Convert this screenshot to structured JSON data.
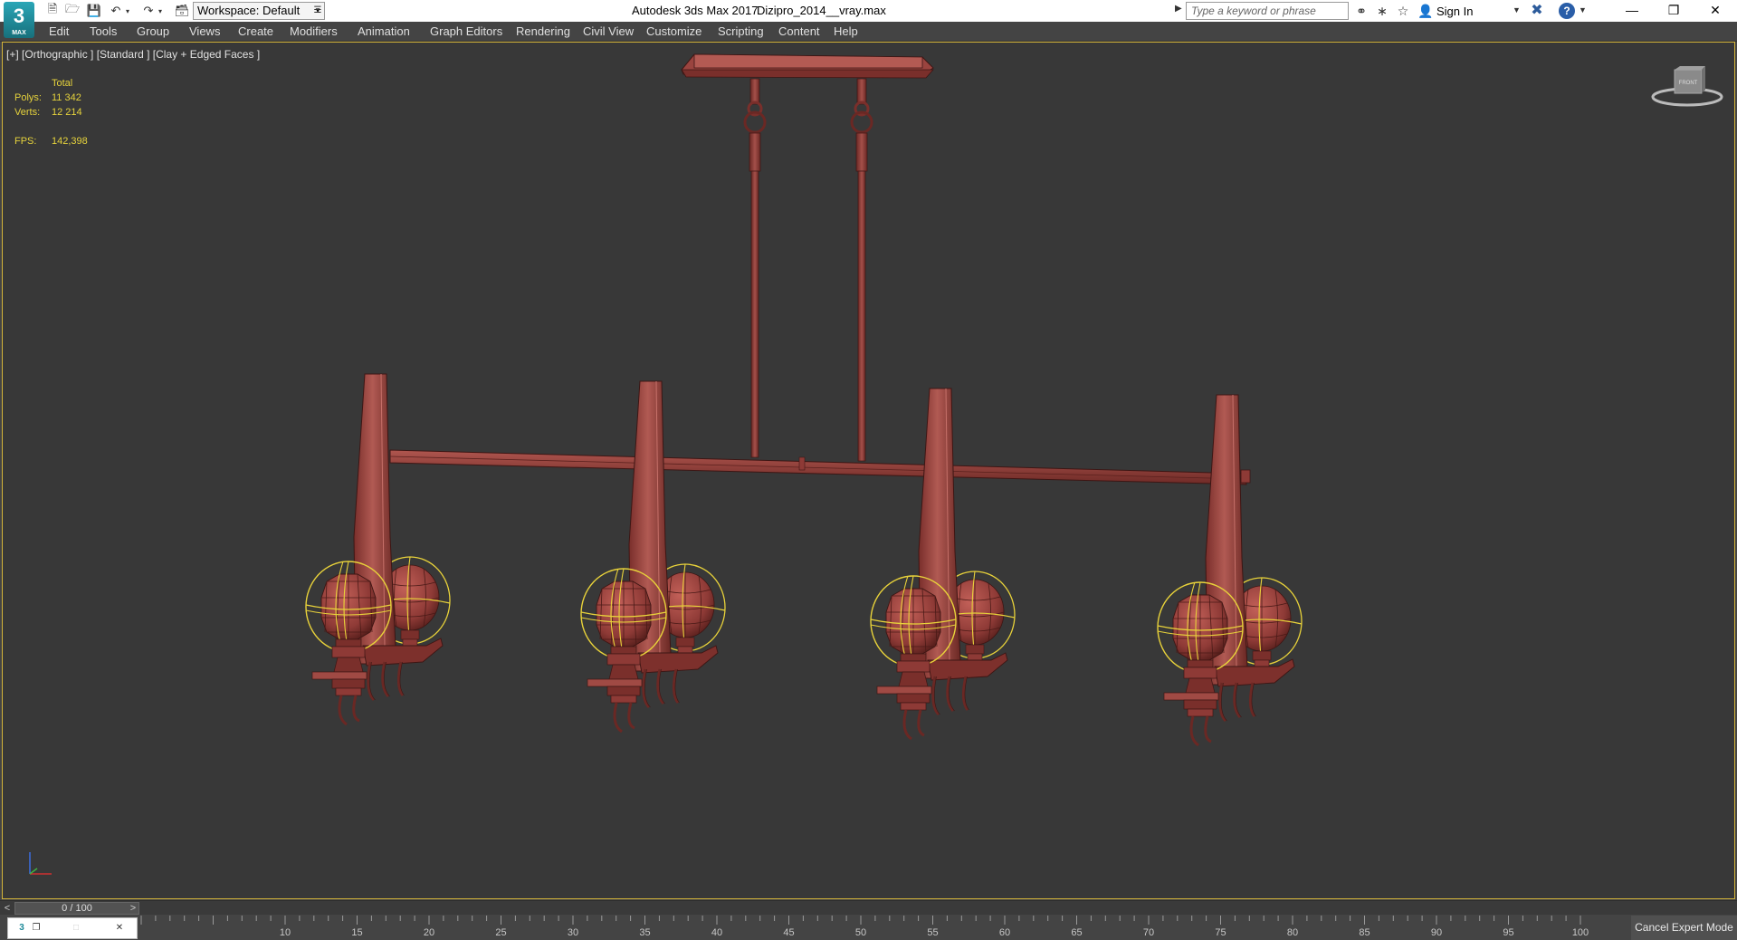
{
  "title_bar": {
    "app_logo": "3",
    "app_logo_sub": "MAX",
    "workspace_label": "Workspace: Default",
    "app_title": "Autodesk 3ds Max 2017",
    "file_name": "Dizipro_2014__vray.max",
    "search_placeholder": "Type a keyword or phrase",
    "sign_in": "Sign In",
    "help": "?"
  },
  "menu": [
    "Edit",
    "Tools",
    "Group",
    "Views",
    "Create",
    "Modifiers",
    "Animation",
    "Graph Editors",
    "Rendering",
    "Civil View",
    "Customize",
    "Scripting",
    "Content",
    "Help"
  ],
  "viewport": {
    "label": "[+] [Orthographic ] [Standard ] [Clay + Edged Faces ]",
    "stats": {
      "total_label": "Total",
      "polys_label": "Polys:",
      "polys_value": "11 342",
      "verts_label": "Verts:",
      "verts_value": "12 214",
      "fps_label": "FPS:",
      "fps_value": "142,398"
    },
    "viewcube_label": "FRONT"
  },
  "time_slider": {
    "value": "0 / 100",
    "prev": "<",
    "next": ">"
  },
  "track_bar": {
    "tick_labels": [
      "10",
      "15",
      "20",
      "25",
      "30",
      "35",
      "40",
      "45",
      "50",
      "55",
      "60",
      "65",
      "70",
      "75",
      "80",
      "85",
      "90",
      "95",
      "100"
    ],
    "cancel_expert_mode": "Cancel Expert Mode"
  },
  "colors": {
    "model": "#8e3a36",
    "model_light": "#a9504a",
    "model_dark": "#5e2320",
    "selection": "#e8d23a",
    "viewport_bg": "#383838",
    "viewport_border": "#d4b43a"
  }
}
